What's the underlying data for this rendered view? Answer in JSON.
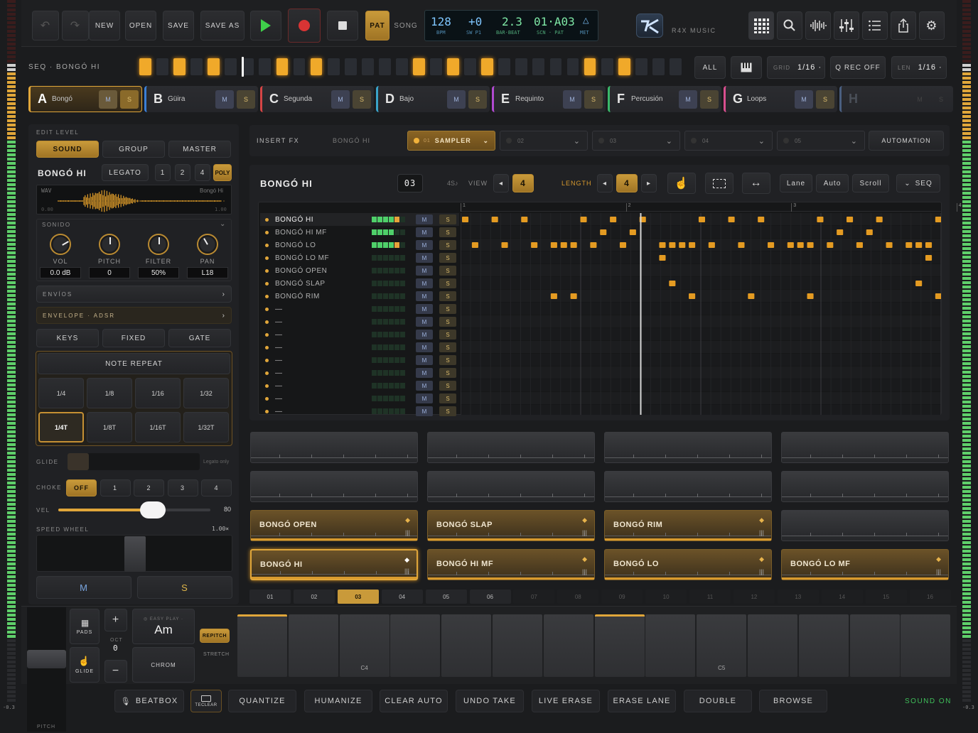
{
  "transport": {
    "undo_label": "↶",
    "redo_label": "↷",
    "new_label": "NEW",
    "open_label": "OPEN",
    "save_label": "SAVE",
    "save_as_label": "SAVE AS",
    "pat_label": "PAT",
    "song_label": "SONG"
  },
  "lcd": {
    "bpm": "128",
    "bpm_label": "BPM",
    "swing": "+0",
    "swing_label": "SW P1",
    "barbeat": "2.3",
    "barbeat_label": "BAR·BEAT",
    "scene": "01·A03",
    "scene_label": "SCN · PAT",
    "met_label": "MET"
  },
  "brand": {
    "name": "R4X MUSIC"
  },
  "seqbar": {
    "title": "SEQ · BONGÓ HI",
    "all_label": "ALL",
    "grid_label": "GRID",
    "grid_value": "1/16 ·",
    "qrec_label": "Q REC OFF",
    "len_label": "LEN",
    "len_value": "1/16 ·",
    "steps_on": [
      1,
      0,
      0,
      0,
      1,
      0,
      0,
      0,
      1,
      0,
      0,
      0,
      0,
      0,
      0,
      0,
      1,
      0,
      0,
      0,
      1,
      0,
      0,
      0,
      0,
      0,
      0,
      0,
      0,
      0,
      0,
      0,
      1,
      0,
      0,
      0,
      1,
      0,
      0,
      0,
      1,
      0,
      0,
      0,
      0,
      0,
      0,
      0,
      0,
      0,
      0,
      0,
      1,
      0,
      0,
      0,
      1,
      0,
      0,
      0,
      0,
      0,
      0,
      0
    ],
    "playhead_step": 24
  },
  "tracks": [
    {
      "letter": "A",
      "name": "Bongó",
      "color": "#e0a63a",
      "active": true
    },
    {
      "letter": "B",
      "name": "Güira",
      "color": "#3b7fd6"
    },
    {
      "letter": "C",
      "name": "Segunda",
      "color": "#d64545"
    },
    {
      "letter": "D",
      "name": "Bajo",
      "color": "#3aa3c9"
    },
    {
      "letter": "E",
      "name": "Requinto",
      "color": "#b04ad0"
    },
    {
      "letter": "F",
      "name": "Percusión",
      "color": "#3ab86a"
    },
    {
      "letter": "G",
      "name": "Loops",
      "color": "#d84f8f"
    },
    {
      "letter": "H",
      "name": "",
      "color": "#4a5f80",
      "dim": true
    }
  ],
  "track_m": "M",
  "track_s": "S",
  "edit": {
    "level_label": "EDIT LEVEL",
    "sound_label": "SOUND",
    "group_label": "GROUP",
    "master_label": "MASTER",
    "sample_name": "BONGÓ HI",
    "legato_label": "LEGATO",
    "voices": [
      "1",
      "2",
      "4"
    ],
    "poly_label": "POLY",
    "wav_label": "WAV",
    "wav_name": "Bongó Hi",
    "wav_start": "0.00",
    "wav_end": "1.00",
    "sonido_label": "SONIDO",
    "knobs": [
      {
        "label": "VOL",
        "value": "0.0 dB",
        "angle": 60
      },
      {
        "label": "PITCH",
        "value": "0",
        "angle": 0
      },
      {
        "label": "FILTER",
        "value": "50%",
        "angle": 0
      },
      {
        "label": "PAN",
        "value": "L18",
        "angle": -30
      }
    ],
    "envios_label": "ENVÍOS",
    "envelope_label": "ENVELOPE · ADSR",
    "keys_label": "KEYS",
    "fixed_label": "FIXED",
    "gate_label": "GATE",
    "note_repeat_label": "NOTE REPEAT",
    "rates": [
      "1/4",
      "1/8",
      "1/16",
      "1/32",
      "1/4T",
      "1/8T",
      "1/16T",
      "1/32T"
    ],
    "rate_selected": 4,
    "glide_label": "GLIDE",
    "glide_note": "Legato only",
    "choke_label": "CHOKE",
    "choke_options": [
      "OFF",
      "1",
      "2",
      "3",
      "4"
    ],
    "vel_label": "VEL",
    "vel_value": "80",
    "vel_fraction": 0.62,
    "speed_label": "SPEED WHEEL",
    "speed_value": "1.00×",
    "m_label": "M",
    "s_label": "S"
  },
  "fx": {
    "insert_label": "INSERT FX",
    "target": "BONGÓ HI",
    "slot1_num": "01",
    "slot1_name": "SAMPLER",
    "slots": [
      "02",
      "03",
      "04",
      "05"
    ],
    "automation_label": "AUTOMATION"
  },
  "editor": {
    "title": "BONGÓ HI",
    "pattern_num": "03",
    "time_sig": "4S♪",
    "view_label": "VIEW",
    "view_value": "4",
    "length_label": "LENGTH",
    "length_value": "4",
    "lane_label": "Lane",
    "auto_label": "Auto",
    "scroll_label": "Scroll",
    "seq_label": "SEQ",
    "bars": [
      "1",
      "2",
      "3",
      "4"
    ],
    "rows": [
      {
        "name": "BONGÓ HI",
        "level": 5
      },
      {
        "name": "BONGÓ HI MF",
        "level": 4
      },
      {
        "name": "BONGÓ LO",
        "level": 5
      },
      {
        "name": "BONGÓ LO MF",
        "level": 0
      },
      {
        "name": "BONGÓ OPEN",
        "level": 0
      },
      {
        "name": "BONGÓ SLAP",
        "level": 0
      },
      {
        "name": "BONGÓ RIM",
        "level": 0
      },
      {
        "name": "—",
        "level": 0
      },
      {
        "name": "—",
        "level": 0
      },
      {
        "name": "—",
        "level": 0
      },
      {
        "name": "—",
        "level": 0
      },
      {
        "name": "—",
        "level": 0
      },
      {
        "name": "—",
        "level": 0
      },
      {
        "name": "—",
        "level": 0
      },
      {
        "name": "—",
        "level": 0
      },
      {
        "name": "—",
        "level": 0
      }
    ],
    "notes": [
      [
        0,
        0
      ],
      [
        0,
        3
      ],
      [
        0,
        6
      ],
      [
        0,
        12
      ],
      [
        0,
        15
      ],
      [
        0,
        18
      ],
      [
        0,
        24
      ],
      [
        0,
        27
      ],
      [
        0,
        30
      ],
      [
        0,
        36
      ],
      [
        0,
        39
      ],
      [
        0,
        42
      ],
      [
        0,
        48
      ],
      [
        0,
        51
      ],
      [
        0,
        54
      ],
      [
        0,
        60
      ],
      [
        1,
        14
      ],
      [
        1,
        17
      ],
      [
        1,
        38
      ],
      [
        1,
        41
      ],
      [
        1,
        50
      ],
      [
        1,
        53
      ],
      [
        2,
        1
      ],
      [
        2,
        4
      ],
      [
        2,
        7
      ],
      [
        2,
        9
      ],
      [
        2,
        10
      ],
      [
        2,
        11
      ],
      [
        2,
        13
      ],
      [
        2,
        16
      ],
      [
        2,
        20
      ],
      [
        2,
        21
      ],
      [
        2,
        22
      ],
      [
        2,
        23
      ],
      [
        2,
        25
      ],
      [
        2,
        28
      ],
      [
        2,
        31
      ],
      [
        2,
        33
      ],
      [
        2,
        34
      ],
      [
        2,
        35
      ],
      [
        2,
        37
      ],
      [
        2,
        40
      ],
      [
        2,
        43
      ],
      [
        2,
        45
      ],
      [
        2,
        46
      ],
      [
        2,
        47
      ],
      [
        3,
        20
      ],
      [
        3,
        47
      ],
      [
        5,
        21
      ],
      [
        5,
        46
      ],
      [
        6,
        9
      ],
      [
        6,
        11
      ],
      [
        6,
        23
      ],
      [
        6,
        29
      ],
      [
        6,
        35
      ],
      [
        6,
        48
      ]
    ],
    "playhead_step": 18,
    "total_steps": 49
  },
  "pads": [
    {
      "name": "",
      "state": "empty"
    },
    {
      "name": "",
      "state": "empty"
    },
    {
      "name": "",
      "state": "empty"
    },
    {
      "name": "",
      "state": "empty"
    },
    {
      "name": "",
      "state": "empty"
    },
    {
      "name": "",
      "state": "empty"
    },
    {
      "name": "",
      "state": "empty"
    },
    {
      "name": "",
      "state": "empty"
    },
    {
      "name": "BONGÓ OPEN",
      "state": "on"
    },
    {
      "name": "BONGÓ SLAP",
      "state": "on"
    },
    {
      "name": "BONGÓ RIM",
      "state": "on"
    },
    {
      "name": "",
      "state": "empty"
    },
    {
      "name": "BONGÓ HI",
      "state": "sel"
    },
    {
      "name": "BONGÓ HI MF",
      "state": "on"
    },
    {
      "name": "BONGÓ LO",
      "state": "on"
    },
    {
      "name": "BONGÓ LO MF",
      "state": "on"
    }
  ],
  "pattern_slots": [
    "01",
    "02",
    "03",
    "04",
    "05",
    "06",
    "07",
    "08",
    "09",
    "10",
    "11",
    "12",
    "13",
    "14",
    "15",
    "16"
  ],
  "pattern_selected": 2,
  "keyboard": {
    "pads_label": "PADS",
    "glide_label": "GLIDE",
    "oct_label": "OCT",
    "oct_value": "0",
    "easy_play_label": "◎ EASY PLAY ·",
    "chord": "Am",
    "chrom_label": "CHROM",
    "repitch_label": "REPITCH",
    "stretch_label": "STRETCH",
    "plus": "+",
    "minus": "−",
    "key_labels": [
      "",
      "",
      "C4",
      "",
      "",
      "",
      "",
      "",
      "",
      "C5",
      "",
      "",
      "",
      ""
    ],
    "highlight_keys": [
      0,
      7
    ]
  },
  "pitch_label": "PITCH",
  "meter_left_db": "-0.3",
  "meter_right_db": "-0.3",
  "bottom": {
    "beatbox": "BEATBOX",
    "teclear": "TECLEAR",
    "quantize": "QUANTIZE",
    "humanize": "HUMANIZE",
    "clear_auto": "CLEAR AUTO",
    "undo_take": "UNDO TAKE",
    "live_erase": "LIVE ERASE",
    "erase_lane": "ERASE LANE",
    "double": "DOUBLE",
    "browse": "BROWSE",
    "sound_on": "SOUND ON"
  }
}
